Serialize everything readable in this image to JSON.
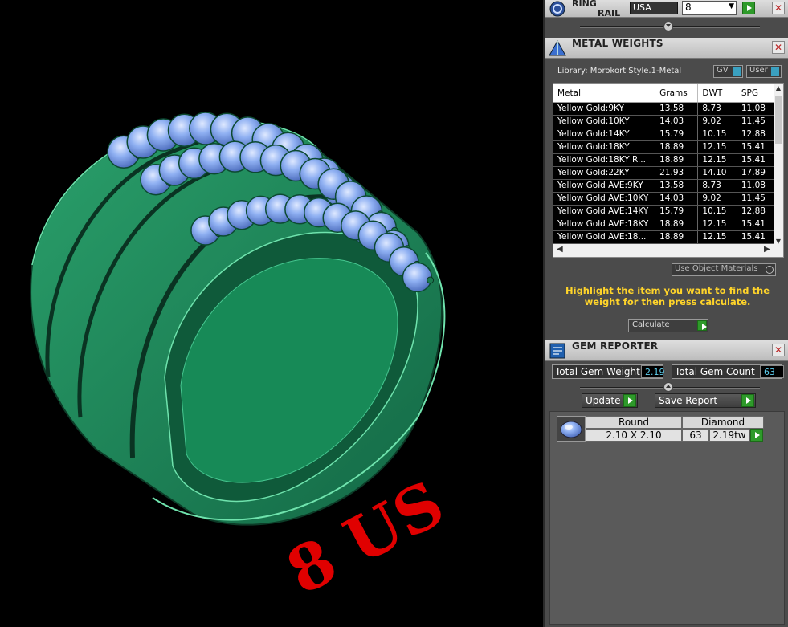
{
  "viewport": {
    "size_label": "8 US",
    "ring_color": "#1f8a5b",
    "gem_color": "#7fa6ef",
    "text_color": "#e00000"
  },
  "ring_rail": {
    "title_line1": "RING",
    "title_line2": "RAIL",
    "region": "USA",
    "size_value": "8"
  },
  "metal_weights": {
    "title": "METAL WEIGHTS",
    "library": "Library: Morokort Style.1-Metal",
    "toggle_gv": "GV",
    "toggle_user": "User",
    "columns": [
      "Metal",
      "Grams",
      "DWT",
      "SPG"
    ],
    "rows": [
      [
        "Yellow Gold:9KY",
        "13.58",
        "8.73",
        "11.08"
      ],
      [
        "Yellow Gold:10KY",
        "14.03",
        "9.02",
        "11.45"
      ],
      [
        "Yellow Gold:14KY",
        "15.79",
        "10.15",
        "12.88"
      ],
      [
        "Yellow Gold:18KY",
        "18.89",
        "12.15",
        "15.41"
      ],
      [
        "Yellow Gold:18KY R...",
        "18.89",
        "12.15",
        "15.41"
      ],
      [
        "Yellow Gold:22KY",
        "21.93",
        "14.10",
        "17.89"
      ],
      [
        "Yellow Gold AVE:9KY",
        "13.58",
        "8.73",
        "11.08"
      ],
      [
        "Yellow Gold AVE:10KY",
        "14.03",
        "9.02",
        "11.45"
      ],
      [
        "Yellow Gold AVE:14KY",
        "15.79",
        "10.15",
        "12.88"
      ],
      [
        "Yellow Gold AVE:18KY",
        "18.89",
        "12.15",
        "15.41"
      ],
      [
        "Yellow Gold AVE:18...",
        "18.89",
        "12.15",
        "15.41"
      ]
    ],
    "use_object_materials": "Use Object Materials",
    "hint": "Highlight the item you want to find the weight for then press calculate.",
    "calculate_label": "Calculate"
  },
  "gem_reporter": {
    "title": "GEM REPORTER",
    "total_weight_label": "Total Gem Weight",
    "total_weight_value": "2.19",
    "total_count_label": "Total Gem Count",
    "total_count_value": "63",
    "update_label": "Update",
    "save_report_label": "Save Report",
    "gem": {
      "shape": "Round",
      "material": "Diamond",
      "size": "2.10 X 2.10",
      "count": "63",
      "weight": "2.19tw"
    }
  }
}
